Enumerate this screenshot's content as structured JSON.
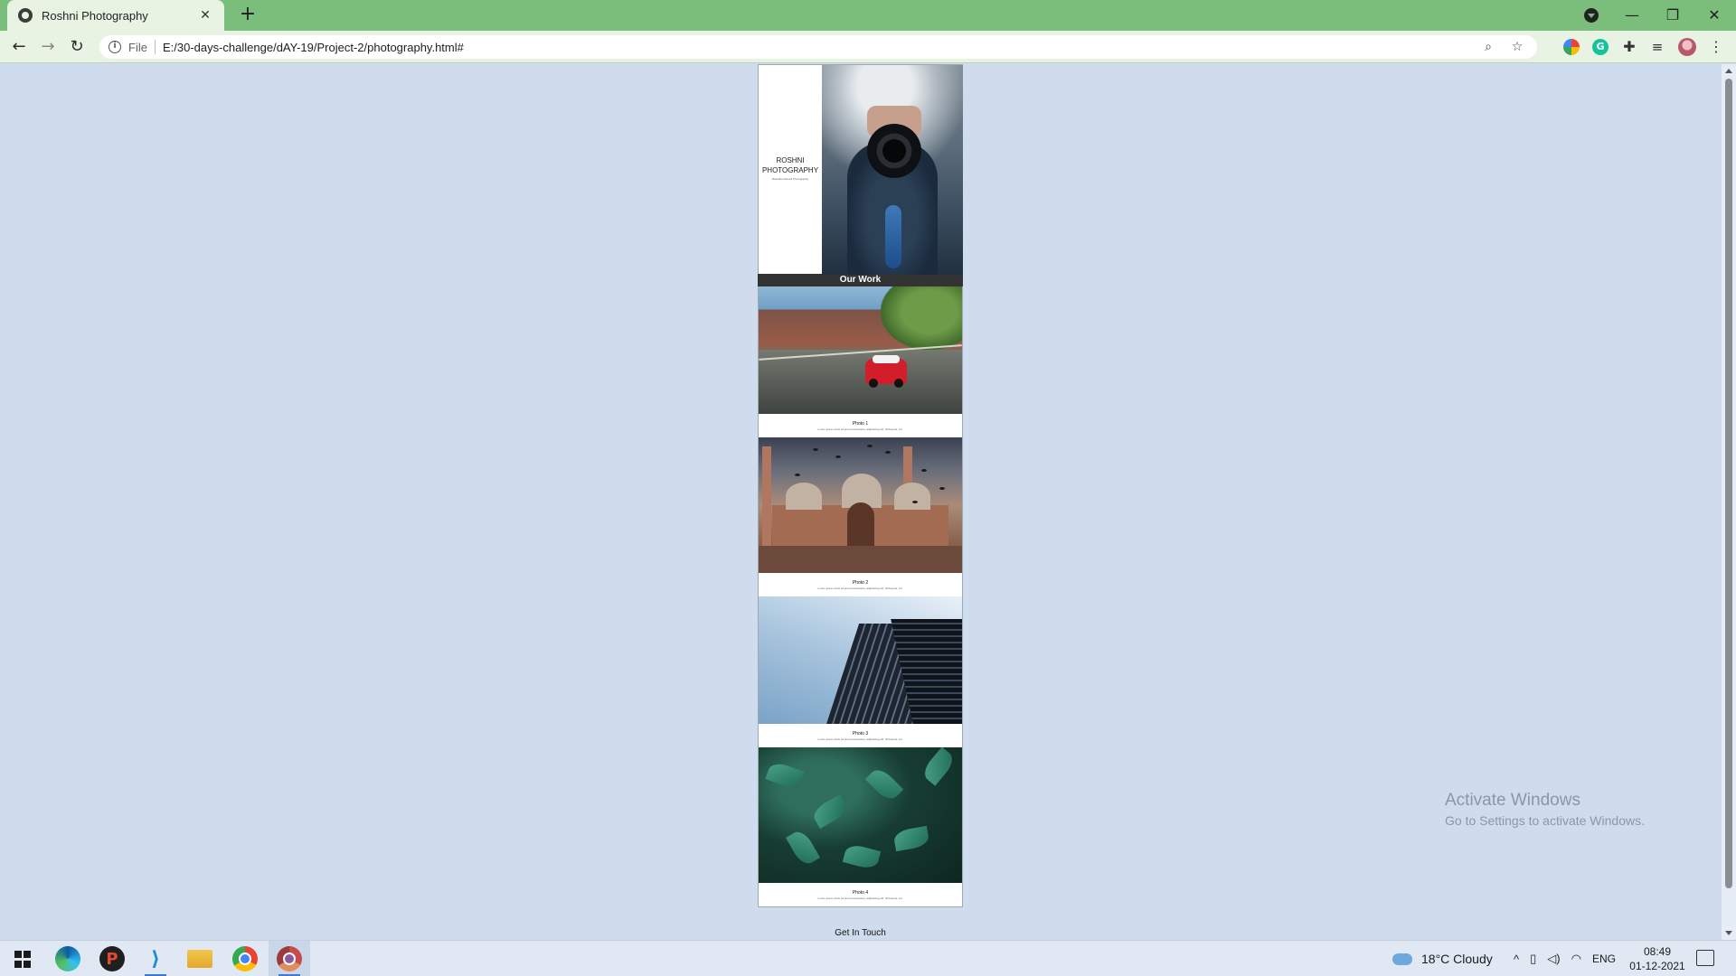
{
  "browser": {
    "tab_title": "Roshni Photography",
    "tab_close": "✕",
    "new_tab": "+",
    "scheme": "File",
    "url": "E:/30-days-challenge/dAY-19/Project-2/photography.html#",
    "window_controls": {
      "minimize": "—",
      "restore": "❐",
      "close": "✕"
    },
    "nav": {
      "back": "←",
      "forward": "→",
      "reload": "↻"
    },
    "icons": [
      "zoom-icon",
      "star-icon",
      "color-extension-icon",
      "grammarly-icon",
      "puzzle-icon",
      "reading-list-icon",
      "avatar",
      "menu-icon"
    ]
  },
  "page": {
    "brand_name": "ROSHNI PHOTOGRAPHY",
    "brand_tagline": "Beautiful Natural Photography",
    "section_title": "Our Work",
    "photos": [
      {
        "title": "Photo 1",
        "text": "Lorem ipsum dolor sit amet consectetur, adipisicing elit. Obcaecati, vel."
      },
      {
        "title": "Photo 2",
        "text": "Lorem ipsum dolor sit amet consectetur, adipisicing elit. Obcaecati, vel."
      },
      {
        "title": "Photo 3",
        "text": "Lorem ipsum dolor sit amet consectetur, adipisicing elit. Obcaecati, vel."
      },
      {
        "title": "Photo 4",
        "text": "Lorem ipsum dolor sit amet consectetur, adipisicing elit. Obcaecati, vel."
      }
    ],
    "contact_label": "Get In Touch"
  },
  "watermark": {
    "title": "Activate Windows",
    "subtitle": "Go to Settings to activate Windows."
  },
  "taskbar": {
    "weather": "18°C  Cloudy",
    "language": "ENG",
    "time": "08:49",
    "date": "01-12-2021",
    "apps": [
      "start-button",
      "edge-icon",
      "paint-icon",
      "vscode-icon",
      "file-explorer-icon",
      "chrome-icon",
      "chrome-profile-icon"
    ]
  },
  "colors": {
    "tabstrip": "#7bbd7b",
    "toolbar": "#e8f3e4",
    "page_background": "#cfdcee",
    "section_title_bg": "#333333"
  }
}
